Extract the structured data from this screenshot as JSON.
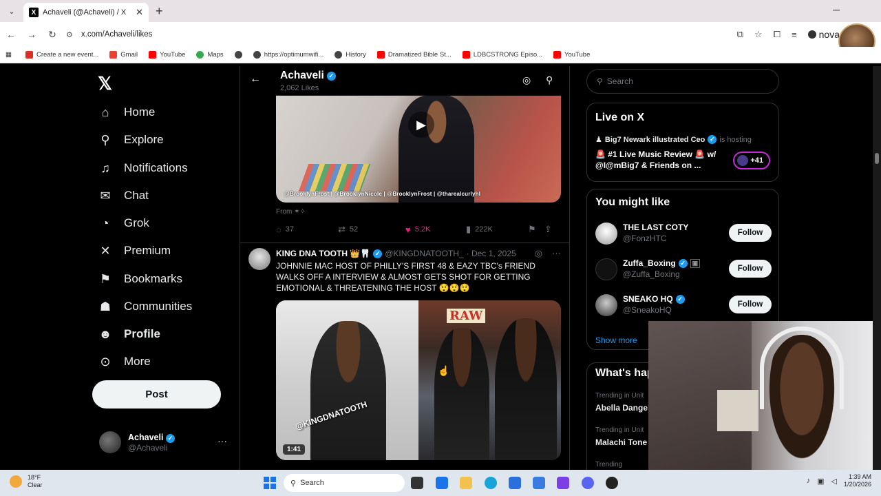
{
  "browser": {
    "tab_title": "Achaveli (@Achaveli) / X",
    "url": "x.com/Achaveli/likes",
    "profile_name": "nova",
    "bookmarks": [
      {
        "label": "Create a new event...",
        "color": "#d93025"
      },
      {
        "label": "Gmail",
        "color": "#ea4335"
      },
      {
        "label": "YouTube",
        "color": "#ff0000"
      },
      {
        "label": "Maps",
        "color": "#34a853"
      },
      {
        "label": "",
        "color": "#444444"
      },
      {
        "label": "https://optimumwifi...",
        "color": "#444444"
      },
      {
        "label": "History",
        "color": "#444444"
      },
      {
        "label": "Dramatized Bible St...",
        "color": "#ff0000"
      },
      {
        "label": "LDBCSTRONG Episo...",
        "color": "#ff0000"
      },
      {
        "label": "YouTube",
        "color": "#ff0000"
      }
    ]
  },
  "nav": {
    "items": [
      {
        "label": "Home",
        "icon": "home-icon",
        "glyph": "⌂"
      },
      {
        "label": "Explore",
        "icon": "search-icon",
        "glyph": "⚲"
      },
      {
        "label": "Notifications",
        "icon": "bell-icon",
        "glyph": "🔔"
      },
      {
        "label": "Chat",
        "icon": "mail-icon",
        "glyph": "✉"
      },
      {
        "label": "Grok",
        "icon": "grok-icon",
        "glyph": "◔"
      },
      {
        "label": "Premium",
        "icon": "x-icon",
        "glyph": "𝕏"
      },
      {
        "label": "Bookmarks",
        "icon": "bookmark-icon",
        "glyph": "🔖"
      },
      {
        "label": "Communities",
        "icon": "communities-icon",
        "glyph": "👥"
      },
      {
        "label": "Profile",
        "icon": "profile-icon",
        "glyph": "👤"
      },
      {
        "label": "More",
        "icon": "more-icon",
        "glyph": "⋯"
      }
    ],
    "post_label": "Post",
    "account_name": "Achaveli",
    "account_handle": "@Achaveli"
  },
  "header": {
    "title": "Achaveli",
    "subtitle": "2,062 Likes"
  },
  "post1": {
    "video_caption": "@BrooklynFrost | @BrooklynNicole | @BrooklynFrost | @thareaIcurlyhl",
    "from": "From ✶✧",
    "replies": "37",
    "reposts": "52",
    "likes": "5.2K",
    "views": "222K"
  },
  "post2": {
    "name": "KING DNA TOOTH 👑🦷",
    "handle": "@KINGDNATOOTH_",
    "date": "· Dec 1, 2025",
    "text": "JOHNNIE MAC HOST OF PHILLY'S FIRST 48 & EAZY TBC's FRIEND WALKS OFF A INTERVIEW & ALMOST GETS SHOT FOR GETTING EMOTIONAL & THREATENING THE HOST 😲😲😲",
    "video_watermark": "@KINGDNATOOTH",
    "video_sign": "RAW",
    "duration": "1:41"
  },
  "sidebar": {
    "search_placeholder": "Search",
    "live_title": "Live on X",
    "live_host_name": "Big7 Newark illustrated Ceo",
    "live_host_suffix": "is hosting",
    "live_space_title": "🚨 #1 Live Music Review 🚨 w/ @I@mBig7 & Friends on ...",
    "live_count": "+41",
    "wtf_title": "You might like",
    "follow_label": "Follow",
    "suggestions": [
      {
        "name": "THE LAST COTY",
        "handle": "@FonzHTC",
        "verified": false
      },
      {
        "name": "Zuffa_Boxing",
        "handle": "@Zuffa_Boxing",
        "verified": true
      },
      {
        "name": "SNEAKO HQ",
        "handle": "@SneakoHQ",
        "verified": true
      }
    ],
    "show_more": "Show more",
    "happening_title": "What's happening",
    "trends": [
      {
        "context": "Trending in Unit",
        "name": "Abella Dange"
      },
      {
        "context": "Trending in Unit",
        "name": "Malachi Tone"
      },
      {
        "context": "Trending",
        "name": ""
      }
    ]
  },
  "taskbar": {
    "temp": "18°F",
    "condition": "Clear",
    "search_label": "Search",
    "time": "1:39 AM",
    "date": "1/20/2026"
  }
}
